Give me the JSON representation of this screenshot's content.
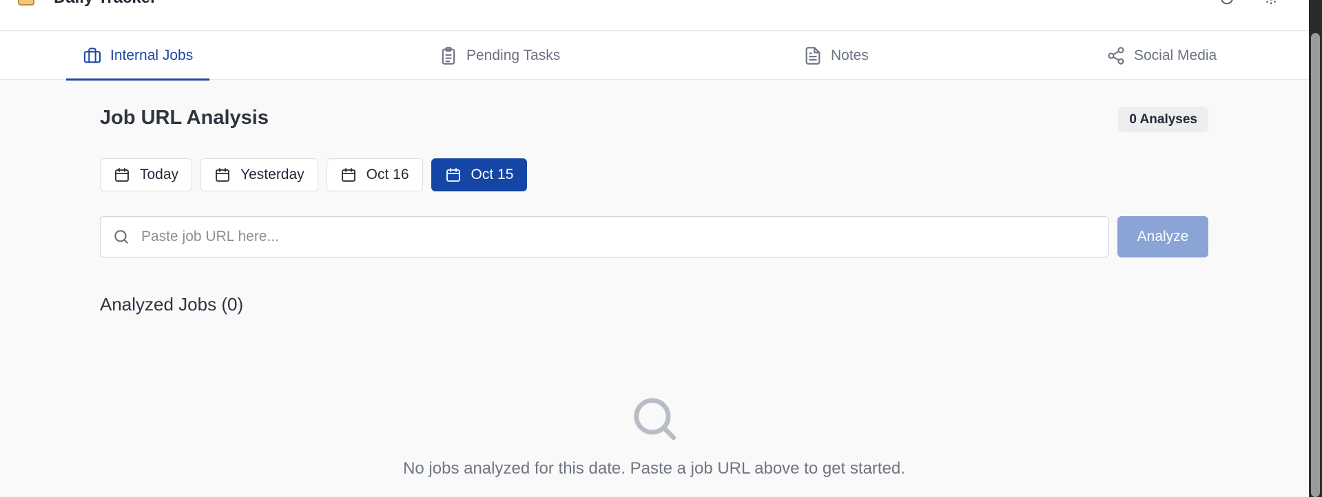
{
  "app": {
    "title": "Daily Tracker"
  },
  "tabs": [
    {
      "label": "Internal Jobs",
      "icon": "briefcase-icon",
      "active": true
    },
    {
      "label": "Pending Tasks",
      "icon": "clipboard-icon",
      "active": false
    },
    {
      "label": "Notes",
      "icon": "document-icon",
      "active": false
    },
    {
      "label": "Social Media",
      "icon": "share-icon",
      "active": false
    }
  ],
  "main": {
    "title": "Job URL Analysis",
    "analyses_badge": "0 Analyses",
    "date_buttons": [
      {
        "label": "Today",
        "active": false
      },
      {
        "label": "Yesterday",
        "active": false
      },
      {
        "label": "Oct 16",
        "active": false
      },
      {
        "label": "Oct 15",
        "active": true
      }
    ],
    "search": {
      "placeholder": "Paste job URL here...",
      "value": ""
    },
    "analyze_label": "Analyze",
    "list_title": "Analyzed Jobs (0)",
    "empty_message": "No jobs analyzed for this date. Paste a job URL above to get started."
  },
  "colors": {
    "accent": "#1d47a3",
    "analyze_disabled": "#8aa4d6",
    "background": "#f9f9fa"
  }
}
